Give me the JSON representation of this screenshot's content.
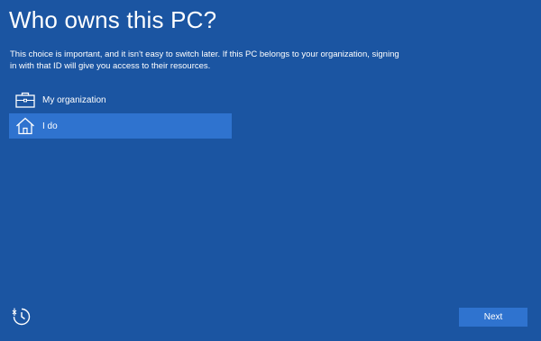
{
  "page": {
    "title": "Who owns this PC?",
    "description": "This choice is important, and it isn't easy to switch later. If this PC belongs to your organization, signing in with that ID will give you access to their resources."
  },
  "options": [
    {
      "label": "My organization",
      "icon": "briefcase-icon",
      "selected": false
    },
    {
      "label": "I do",
      "icon": "home-icon",
      "selected": true
    }
  ],
  "footer": {
    "accessibility_icon": "ease-of-access-icon",
    "next_label": "Next"
  },
  "colors": {
    "background": "#1b55a2",
    "selected": "#2f73cf",
    "button": "#2f73cf",
    "text": "#ffffff"
  }
}
